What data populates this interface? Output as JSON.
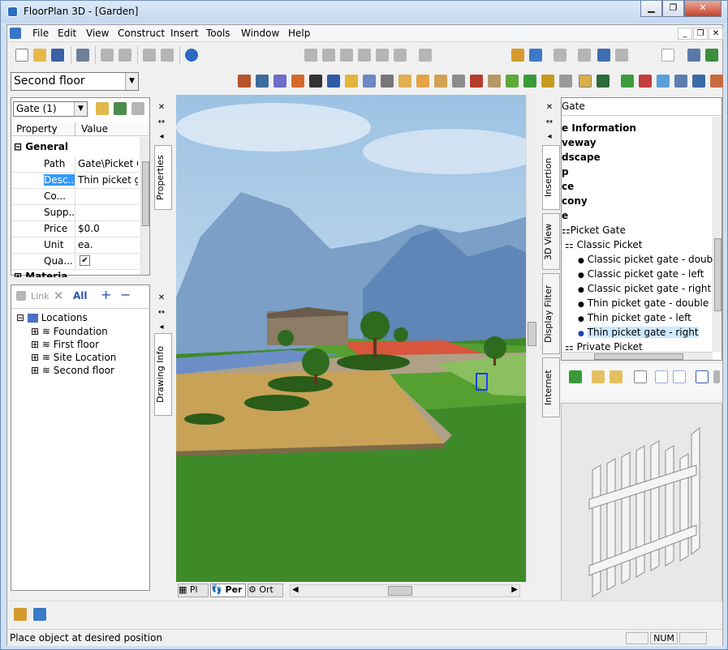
{
  "window": {
    "title": "FloorPlan 3D - [Garden]"
  },
  "menu": [
    "File",
    "Edit",
    "View",
    "Construct",
    "Insert",
    "Tools",
    "Window",
    "Help"
  ],
  "floor_combo": {
    "value": "Second floor"
  },
  "properties": {
    "object_combo": "Gate (1)",
    "col_property": "Property",
    "col_value": "Value",
    "group_general": "General",
    "rows": [
      {
        "name": "Path",
        "value": "Gate\\Picket C"
      },
      {
        "name": "Desc...",
        "value": "Thin picket g"
      },
      {
        "name": "Co...",
        "value": ""
      },
      {
        "name": "Supp...",
        "value": ""
      },
      {
        "name": "Price",
        "value": "$0.0"
      },
      {
        "name": "Unit",
        "value": "ea."
      },
      {
        "name": "Qua...",
        "value": "✔"
      }
    ],
    "group_material": "Materia",
    "tab_label": "Properties"
  },
  "locations": {
    "toolbar_link": "Link",
    "toolbar_all": "All",
    "toolbar_plus": "+",
    "toolbar_minus": "−",
    "root": "Locations",
    "items": [
      "Foundation",
      "First floor",
      "Site Location",
      "Second floor"
    ],
    "tab_label": "Drawing Info"
  },
  "view_tabs": {
    "plan": "Pl",
    "persp": "Per",
    "ortho": "Ort"
  },
  "insertion": {
    "header": "Gate",
    "items": [
      "e Information",
      "veway",
      "dscape",
      "p",
      "ce",
      "cony",
      "e",
      "Picket Gate",
      "Classic Picket",
      "Classic picket gate - double",
      "Classic picket gate - left",
      "Classic picket gate - right",
      "Thin picket gate - double",
      "Thin picket gate - left",
      "Thin picket gate - right",
      "Private Picket"
    ],
    "tabs": [
      "Insertion",
      "3D View",
      "Display Filter",
      "Internet"
    ]
  },
  "status": {
    "message": "Place object at desired position",
    "num": "NUM"
  },
  "colors": {
    "accent": "#3399ff",
    "selection": "#cce8ff"
  }
}
